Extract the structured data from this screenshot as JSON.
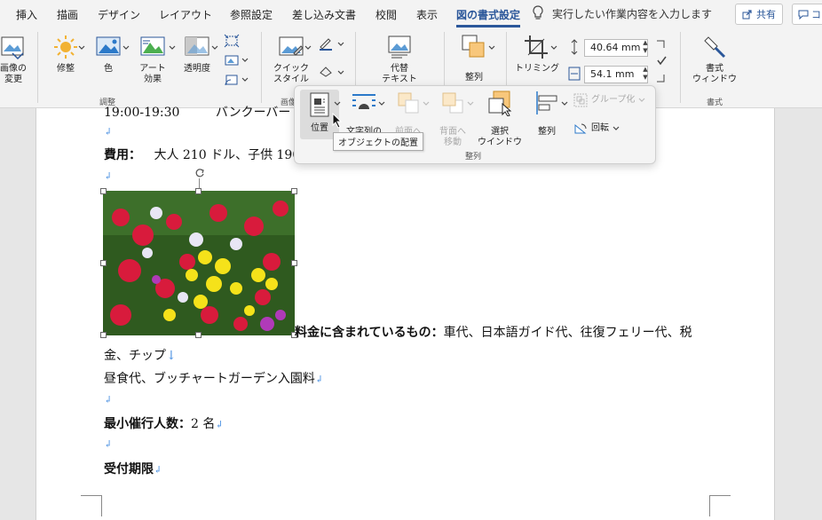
{
  "tabs": {
    "insert": "挿入",
    "draw": "描画",
    "design": "デザイン",
    "layout": "レイアウト",
    "references": "参照設定",
    "mailings": "差し込み文書",
    "review": "校閲",
    "view": "表示",
    "picture_format": "図の書式設定"
  },
  "tell_me": "実行したい作業内容を入力します",
  "share": "共有",
  "comment": "コ",
  "ribbon": {
    "change_picture": "画像の\n変更",
    "corrections": "修整",
    "color": "色",
    "artistic_effects": "アート\n効果",
    "transparency": "透明度",
    "adjust_group": "調整",
    "quick_styles": "クイック\nスタイル",
    "styles_group": "画像の",
    "alt_text": "代替\nテキスト",
    "arrange": "整列",
    "crop": "トリミング",
    "height": "40.64 mm",
    "width": "54.1 mm",
    "format_pane": "書式\nウィンドウ",
    "format_group": "書式"
  },
  "panel": {
    "position": "位置",
    "wrap_text": "文字列の",
    "bring_forward": "前面へ",
    "send_backward": "背面へ\n移動",
    "selection_pane": "選択\nウインドウ",
    "align": "整列",
    "group": "グループ化",
    "rotate": "回転",
    "group_label": "整列"
  },
  "tooltip": "オブジェクトの配置",
  "document": {
    "time_line": "19:00-19:30",
    "time_line_rest": "バンクーバー",
    "fee_label": "費用：",
    "fee_value": "大人 210 ドル、子供 190",
    "included_label": "料金に含まれているもの：",
    "included_value": "車代、日本語ガイド代、往復フェリー代、税",
    "included_cont": "金、チップ",
    "lunch": "昼食代、ブッチャートガーデン入園料",
    "min_people_label": "最小催行人数：",
    "min_people_value": "2 名",
    "deadline_label": "受付期限"
  },
  "colors": {
    "accent": "#2b579a",
    "paragraph_mark": "#4a90e2",
    "ribbon_bg": "#f3f3f3"
  }
}
